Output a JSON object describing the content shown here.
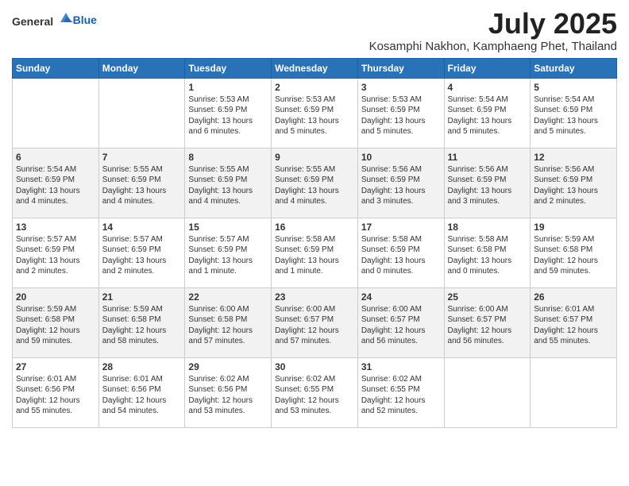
{
  "logo": {
    "text_general": "General",
    "text_blue": "Blue"
  },
  "title": "July 2025",
  "subtitle": "Kosamphi Nakhon, Kamphaeng Phet, Thailand",
  "headers": [
    "Sunday",
    "Monday",
    "Tuesday",
    "Wednesday",
    "Thursday",
    "Friday",
    "Saturday"
  ],
  "weeks": [
    [
      {
        "num": "",
        "info": ""
      },
      {
        "num": "",
        "info": ""
      },
      {
        "num": "1",
        "info": "Sunrise: 5:53 AM\nSunset: 6:59 PM\nDaylight: 13 hours and 6 minutes."
      },
      {
        "num": "2",
        "info": "Sunrise: 5:53 AM\nSunset: 6:59 PM\nDaylight: 13 hours and 5 minutes."
      },
      {
        "num": "3",
        "info": "Sunrise: 5:53 AM\nSunset: 6:59 PM\nDaylight: 13 hours and 5 minutes."
      },
      {
        "num": "4",
        "info": "Sunrise: 5:54 AM\nSunset: 6:59 PM\nDaylight: 13 hours and 5 minutes."
      },
      {
        "num": "5",
        "info": "Sunrise: 5:54 AM\nSunset: 6:59 PM\nDaylight: 13 hours and 5 minutes."
      }
    ],
    [
      {
        "num": "6",
        "info": "Sunrise: 5:54 AM\nSunset: 6:59 PM\nDaylight: 13 hours and 4 minutes."
      },
      {
        "num": "7",
        "info": "Sunrise: 5:55 AM\nSunset: 6:59 PM\nDaylight: 13 hours and 4 minutes."
      },
      {
        "num": "8",
        "info": "Sunrise: 5:55 AM\nSunset: 6:59 PM\nDaylight: 13 hours and 4 minutes."
      },
      {
        "num": "9",
        "info": "Sunrise: 5:55 AM\nSunset: 6:59 PM\nDaylight: 13 hours and 4 minutes."
      },
      {
        "num": "10",
        "info": "Sunrise: 5:56 AM\nSunset: 6:59 PM\nDaylight: 13 hours and 3 minutes."
      },
      {
        "num": "11",
        "info": "Sunrise: 5:56 AM\nSunset: 6:59 PM\nDaylight: 13 hours and 3 minutes."
      },
      {
        "num": "12",
        "info": "Sunrise: 5:56 AM\nSunset: 6:59 PM\nDaylight: 13 hours and 2 minutes."
      }
    ],
    [
      {
        "num": "13",
        "info": "Sunrise: 5:57 AM\nSunset: 6:59 PM\nDaylight: 13 hours and 2 minutes."
      },
      {
        "num": "14",
        "info": "Sunrise: 5:57 AM\nSunset: 6:59 PM\nDaylight: 13 hours and 2 minutes."
      },
      {
        "num": "15",
        "info": "Sunrise: 5:57 AM\nSunset: 6:59 PM\nDaylight: 13 hours and 1 minute."
      },
      {
        "num": "16",
        "info": "Sunrise: 5:58 AM\nSunset: 6:59 PM\nDaylight: 13 hours and 1 minute."
      },
      {
        "num": "17",
        "info": "Sunrise: 5:58 AM\nSunset: 6:59 PM\nDaylight: 13 hours and 0 minutes."
      },
      {
        "num": "18",
        "info": "Sunrise: 5:58 AM\nSunset: 6:58 PM\nDaylight: 13 hours and 0 minutes."
      },
      {
        "num": "19",
        "info": "Sunrise: 5:59 AM\nSunset: 6:58 PM\nDaylight: 12 hours and 59 minutes."
      }
    ],
    [
      {
        "num": "20",
        "info": "Sunrise: 5:59 AM\nSunset: 6:58 PM\nDaylight: 12 hours and 59 minutes."
      },
      {
        "num": "21",
        "info": "Sunrise: 5:59 AM\nSunset: 6:58 PM\nDaylight: 12 hours and 58 minutes."
      },
      {
        "num": "22",
        "info": "Sunrise: 6:00 AM\nSunset: 6:58 PM\nDaylight: 12 hours and 57 minutes."
      },
      {
        "num": "23",
        "info": "Sunrise: 6:00 AM\nSunset: 6:57 PM\nDaylight: 12 hours and 57 minutes."
      },
      {
        "num": "24",
        "info": "Sunrise: 6:00 AM\nSunset: 6:57 PM\nDaylight: 12 hours and 56 minutes."
      },
      {
        "num": "25",
        "info": "Sunrise: 6:00 AM\nSunset: 6:57 PM\nDaylight: 12 hours and 56 minutes."
      },
      {
        "num": "26",
        "info": "Sunrise: 6:01 AM\nSunset: 6:57 PM\nDaylight: 12 hours and 55 minutes."
      }
    ],
    [
      {
        "num": "27",
        "info": "Sunrise: 6:01 AM\nSunset: 6:56 PM\nDaylight: 12 hours and 55 minutes."
      },
      {
        "num": "28",
        "info": "Sunrise: 6:01 AM\nSunset: 6:56 PM\nDaylight: 12 hours and 54 minutes."
      },
      {
        "num": "29",
        "info": "Sunrise: 6:02 AM\nSunset: 6:56 PM\nDaylight: 12 hours and 53 minutes."
      },
      {
        "num": "30",
        "info": "Sunrise: 6:02 AM\nSunset: 6:55 PM\nDaylight: 12 hours and 53 minutes."
      },
      {
        "num": "31",
        "info": "Sunrise: 6:02 AM\nSunset: 6:55 PM\nDaylight: 12 hours and 52 minutes."
      },
      {
        "num": "",
        "info": ""
      },
      {
        "num": "",
        "info": ""
      }
    ]
  ]
}
